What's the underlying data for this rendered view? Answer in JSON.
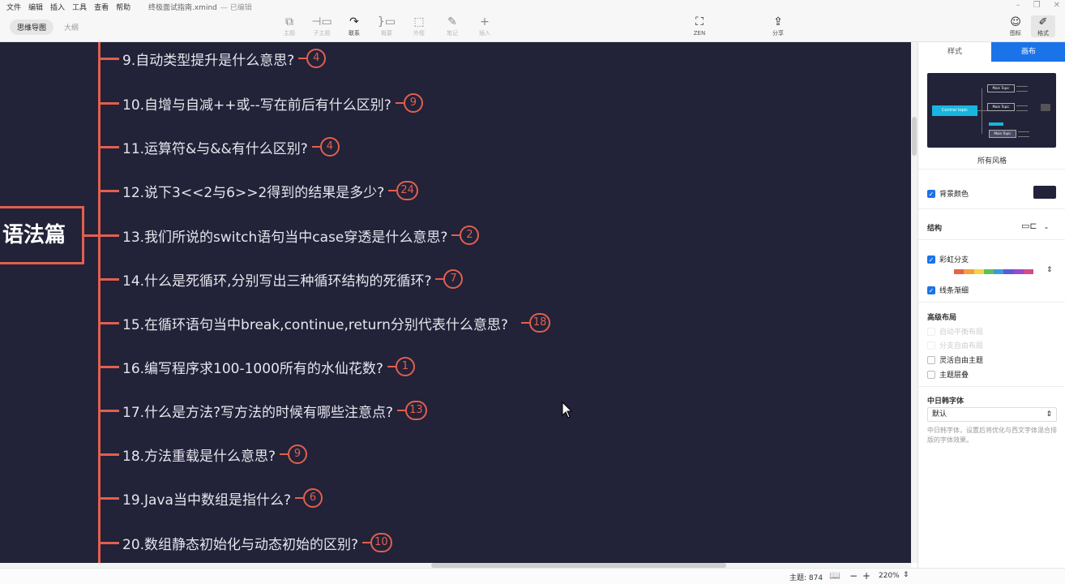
{
  "titlebar": {
    "menus": [
      "文件",
      "编辑",
      "插入",
      "工具",
      "查看",
      "帮助"
    ],
    "filename": "终极面试指南.xmind",
    "saved": "— 已编辑"
  },
  "toolbar": {
    "view_tabs": [
      "思维导图",
      "大纲"
    ],
    "tools": [
      {
        "icon": "topic-icon",
        "label": "主题"
      },
      {
        "icon": "subtopic-icon",
        "label": "子主题"
      },
      {
        "icon": "relationship-icon",
        "label": "联系"
      },
      {
        "icon": "summary-icon",
        "label": "概要"
      },
      {
        "icon": "boundary-icon",
        "label": "外框"
      },
      {
        "icon": "note-icon",
        "label": "笔记"
      },
      {
        "icon": "insert-icon",
        "label": "插入"
      },
      {
        "icon": "zen-icon",
        "label": "ZEN"
      },
      {
        "icon": "share-icon",
        "label": "分享"
      },
      {
        "icon": "sticker-icon",
        "label": "图标"
      },
      {
        "icon": "format-icon",
        "label": "格式"
      }
    ]
  },
  "map": {
    "root": "语法篇",
    "topics": [
      {
        "text": "9.自动类型提升是什么意思?",
        "count": "4"
      },
      {
        "text": "10.自增与自减++或--写在前后有什么区别?",
        "count": "9"
      },
      {
        "text": "11.运算符&与&&有什么区别?",
        "count": "4"
      },
      {
        "text": "12.说下3<<2与6>>2得到的结果是多少?",
        "count": "24"
      },
      {
        "text": "13.我们所说的switch语句当中case穿透是什么意思?",
        "count": "2"
      },
      {
        "text": "14.什么是死循环,分别写出三种循环结构的死循环?",
        "count": "7"
      },
      {
        "text": "15.在循环语句当中break,continue,return分别代表什么意思?",
        "count": "18"
      },
      {
        "text": "16.编写程序求100-1000所有的水仙花数?",
        "count": "1"
      },
      {
        "text": "17.什么是方法?写方法的时候有哪些注意点?",
        "count": "13"
      },
      {
        "text": "18.方法重载是什么意思?",
        "count": "9"
      },
      {
        "text": "19.Java当中数组是指什么?",
        "count": "6"
      },
      {
        "text": "20.数组静态初始化与动态初始的区别?",
        "count": "10"
      }
    ],
    "colors": {
      "background": "#222238",
      "branch": "#e0604f",
      "text": "#e6e6ee"
    }
  },
  "panel": {
    "tabs": [
      "样式",
      "画布"
    ],
    "thumbnail": {
      "central": "Central topic",
      "main": "Main Topic"
    },
    "style_caption": "所有风格",
    "bg_color_label": "背景颜色",
    "structure_label": "结构",
    "rainbow_label": "彩虹分支",
    "rainbow_colors": [
      "#e8604c",
      "#f2a03d",
      "#f3d34a",
      "#5cbf5a",
      "#3a9bdc",
      "#5b5bd6",
      "#9b49c9",
      "#d24a8c"
    ],
    "line_taper_label": "线条渐细",
    "advanced_layout_label": "高级布局",
    "auto_balance_label": "自动平衡布局",
    "branch_free_label": "分支自由布局",
    "flexible_float_label": "灵活自由主题",
    "overlap_label": "主题层叠",
    "cjk_font_label": "中日韩字体",
    "cjk_font_value": "默认",
    "cjk_font_desc": "中日韩字体，设置后将优化与西文字体混合排版的字体效果。"
  },
  "status": {
    "topics": "主题: 874",
    "zoom": "220%"
  }
}
